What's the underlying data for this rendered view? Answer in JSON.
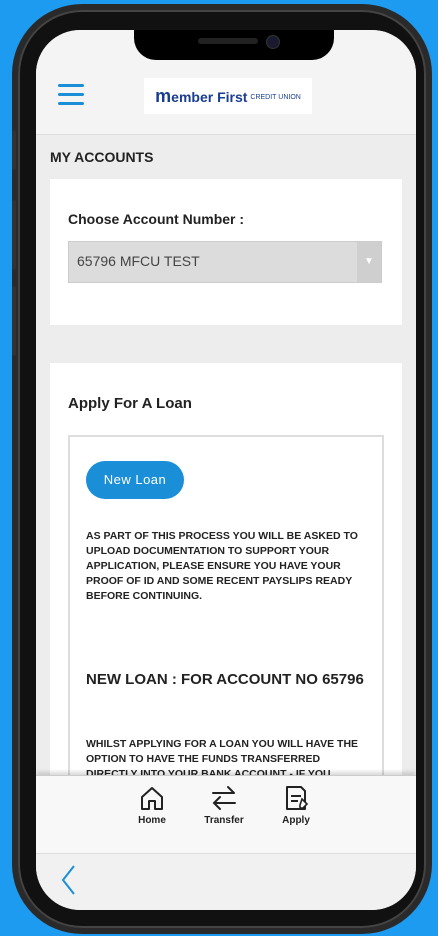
{
  "header": {
    "logo_main": "ember First",
    "logo_m": "m",
    "logo_sub": "CREDIT UNION"
  },
  "section_title": "MY ACCOUNTS",
  "account": {
    "label": "Choose Account Number :",
    "selected": "65796 MFCU TEST"
  },
  "loan": {
    "title": "Apply For A Loan",
    "button": "New Loan",
    "notice": "AS PART OF THIS PROCESS YOU WILL BE ASKED TO UPLOAD DOCUMENTATION TO SUPPORT YOUR APPLICATION, PLEASE ENSURE YOU HAVE YOUR PROOF OF ID AND SOME RECENT PAYSLIPS READY BEFORE CONTINUING.",
    "heading": "NEW LOAN : FOR ACCOUNT NO 65796",
    "whilst": "WHILST APPLYING FOR A LOAN YOU WILL HAVE THE OPTION TO HAVE THE FUNDS TRANSFERRED DIRECTLY INTO YOUR BANK ACCOUNT - IF YOU"
  },
  "tabs": [
    {
      "label": "Home",
      "icon": "home-icon"
    },
    {
      "label": "Transfer",
      "icon": "transfer-icon"
    },
    {
      "label": "Apply",
      "icon": "apply-icon"
    }
  ],
  "colors": {
    "accent": "#1a8fd8",
    "background": "#1c9bf0"
  }
}
